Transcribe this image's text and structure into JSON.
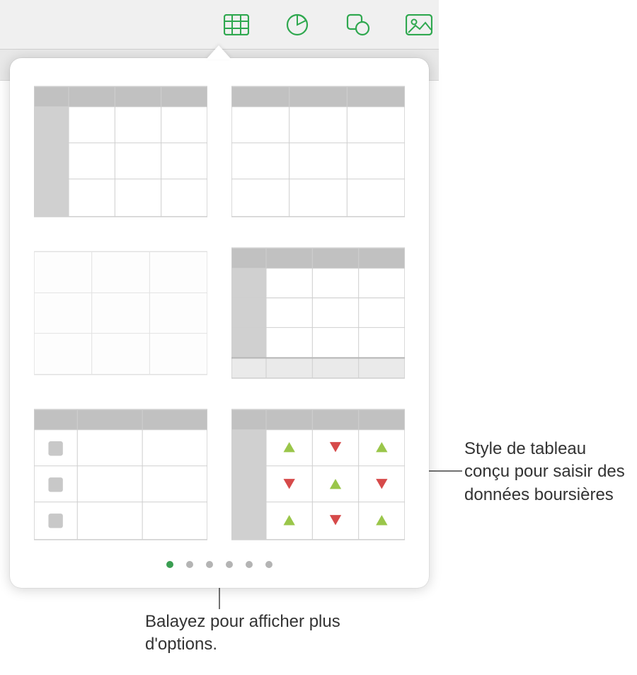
{
  "toolbar": {
    "icons": [
      "table-icon",
      "chart-icon",
      "shape-icon",
      "media-icon"
    ],
    "accent_color": "#2fa84f"
  },
  "popover": {
    "styles": [
      {
        "id": "table-style-header-row-col",
        "desc": "header row and header column"
      },
      {
        "id": "table-style-header-row",
        "desc": "header row only"
      },
      {
        "id": "table-style-plain",
        "desc": "plain grid no headers"
      },
      {
        "id": "table-style-header-footer",
        "desc": "header row col and footer"
      },
      {
        "id": "table-style-checklist",
        "desc": "header row with checkbox column"
      },
      {
        "id": "table-style-stock",
        "desc": "stock data with up/down indicators"
      }
    ],
    "pages": 6,
    "current_page": 1
  },
  "callouts": {
    "stock": "Style de tableau conçu pour saisir des données boursières",
    "pager": "Balayez pour afficher plus d'options."
  },
  "colors": {
    "header_gray": "#c1c1c1",
    "cell_border": "#d8d8d8",
    "green_tri": "#9ac64a",
    "red_tri": "#d64a4a",
    "checkbox": "#b8b8b8"
  }
}
